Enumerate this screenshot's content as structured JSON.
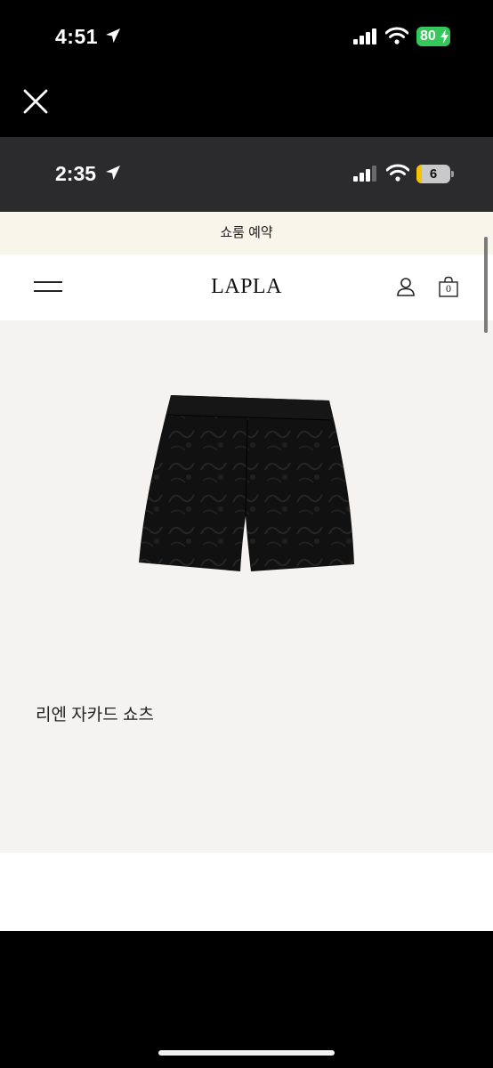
{
  "outer_status": {
    "time": "4:51",
    "battery": "80"
  },
  "inner_status": {
    "time": "2:35",
    "battery": "6"
  },
  "page": {
    "banner": "쇼룸 예약",
    "logo": "LAPLA",
    "cart_count": "0",
    "product_name": "리엔 자카드 쇼츠"
  },
  "icons": {
    "close": "close-icon",
    "menu": "hamburger-menu-icon",
    "user": "user-icon",
    "cart": "shopping-bag-icon"
  },
  "colors": {
    "banner_bg": "#f8f5ea",
    "image_bg": "#f4f3f1",
    "battery_green": "#34c759"
  }
}
